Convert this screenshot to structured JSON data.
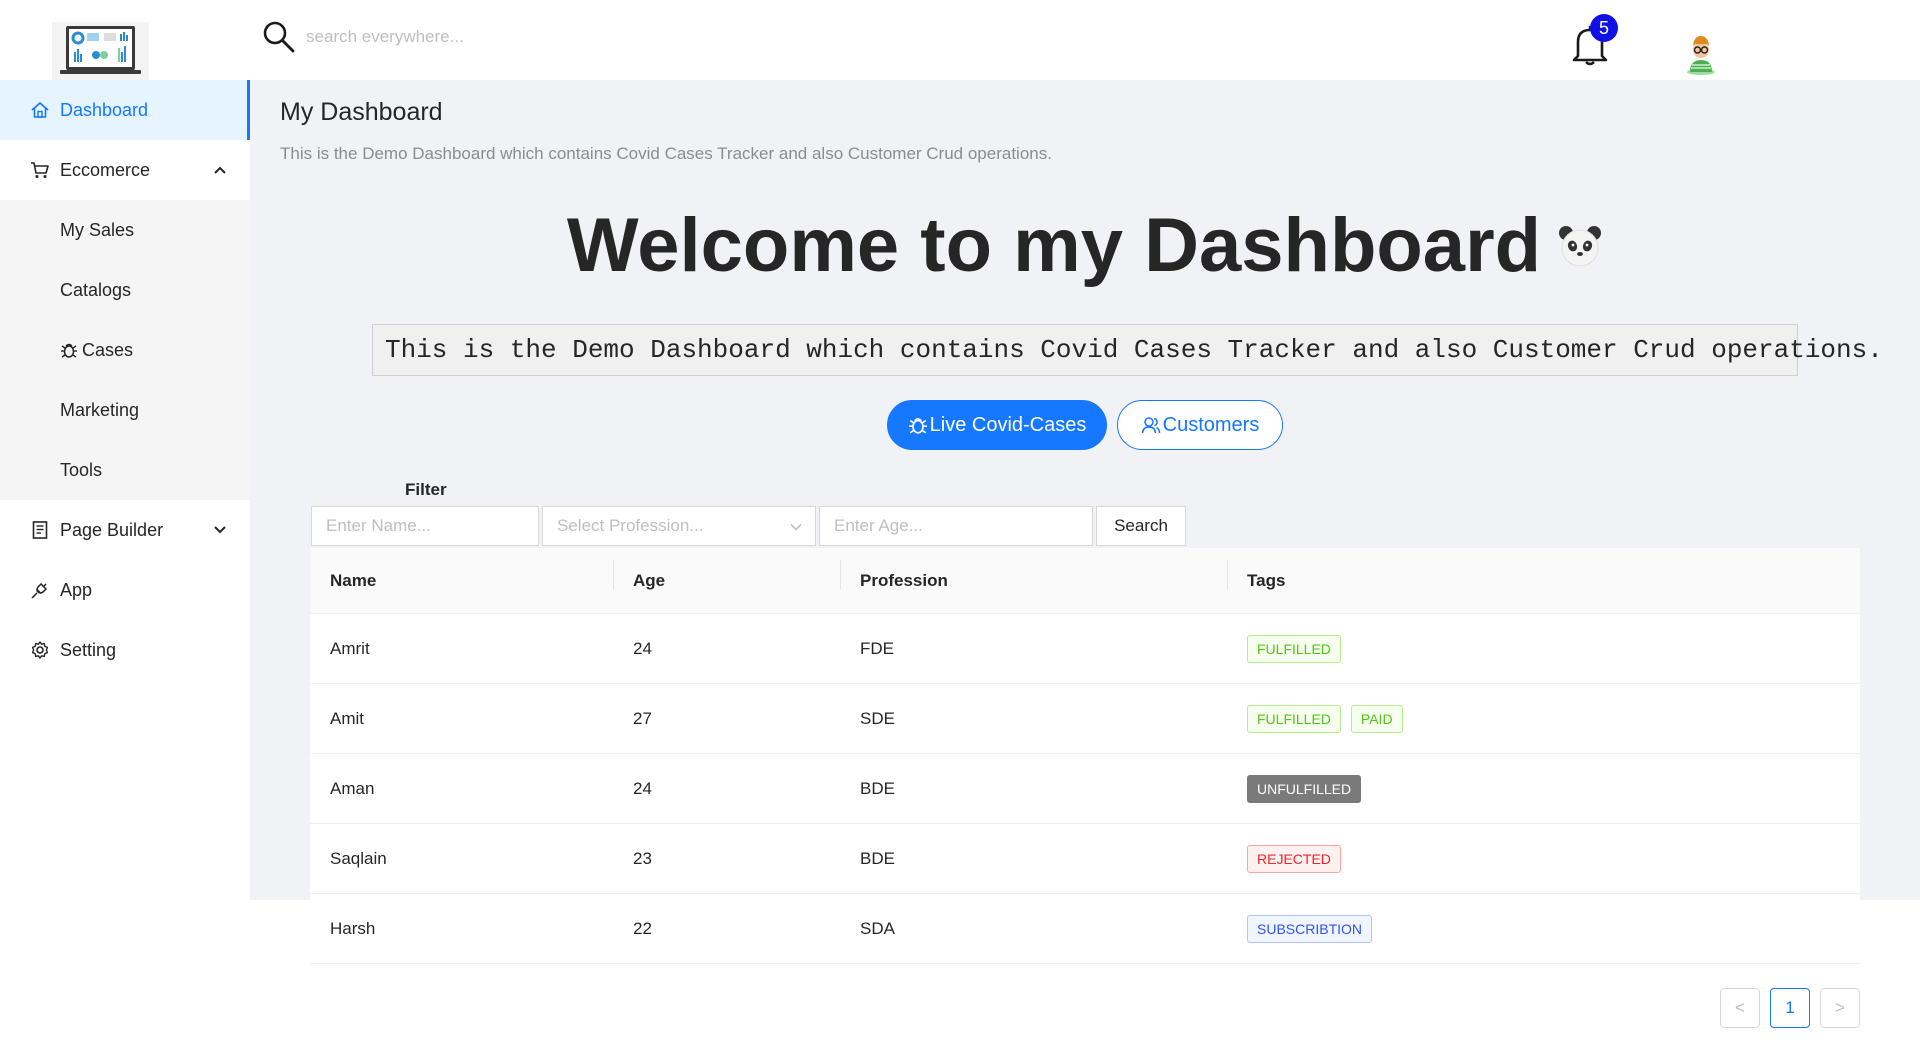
{
  "header": {
    "search_placeholder": "search everywhere...",
    "notification_count": "5"
  },
  "sidebar": {
    "items": [
      {
        "label": "Dashboard",
        "icon": "home-icon"
      },
      {
        "label": "Eccomerce",
        "icon": "cart-icon"
      },
      {
        "label": "My Sales"
      },
      {
        "label": "Catalogs"
      },
      {
        "label": "Cases",
        "icon": "bug-icon"
      },
      {
        "label": "Marketing"
      },
      {
        "label": "Tools"
      },
      {
        "label": "Page Builder",
        "icon": "file-icon"
      },
      {
        "label": "App",
        "icon": "api-icon"
      },
      {
        "label": "Setting",
        "icon": "gear-icon"
      }
    ]
  },
  "main": {
    "title": "My Dashboard",
    "description": "This is the Demo Dashboard which contains Covid Cases Tracker and also Customer Crud operations.",
    "hero": "Welcome to my Dashboard",
    "code_text": "This is the Demo Dashboard which contains Covid Cases Tracker and also Customer Crud operations.",
    "buttons": {
      "covid": "Live Covid-Cases",
      "customers": "Customers"
    }
  },
  "filter": {
    "label": "Filter",
    "name_placeholder": "Enter Name...",
    "profession_placeholder": "Select Profession...",
    "age_placeholder": "Enter Age...",
    "search_label": "Search"
  },
  "table": {
    "columns": [
      "Name",
      "Age",
      "Profession",
      "Tags"
    ],
    "rows": [
      {
        "name": "Amrit",
        "age": "24",
        "profession": "FDE",
        "tags": [
          "FULFILLED"
        ]
      },
      {
        "name": "Amit",
        "age": "27",
        "profession": "SDE",
        "tags": [
          "FULFILLED",
          "PAID"
        ]
      },
      {
        "name": "Aman",
        "age": "24",
        "profession": "BDE",
        "tags": [
          "UNFULFILLED"
        ]
      },
      {
        "name": "Saqlain",
        "age": "23",
        "profession": "BDE",
        "tags": [
          "REJECTED"
        ]
      },
      {
        "name": "Harsh",
        "age": "22",
        "profession": "SDA",
        "tags": [
          "SUBSCRIBTION"
        ]
      }
    ]
  },
  "pagination": {
    "prev": "<",
    "current": "1",
    "next": ">"
  },
  "colors": {
    "accent": "#1677ff",
    "badge": "#1010e6",
    "content_bg": "#f0f2f5"
  }
}
